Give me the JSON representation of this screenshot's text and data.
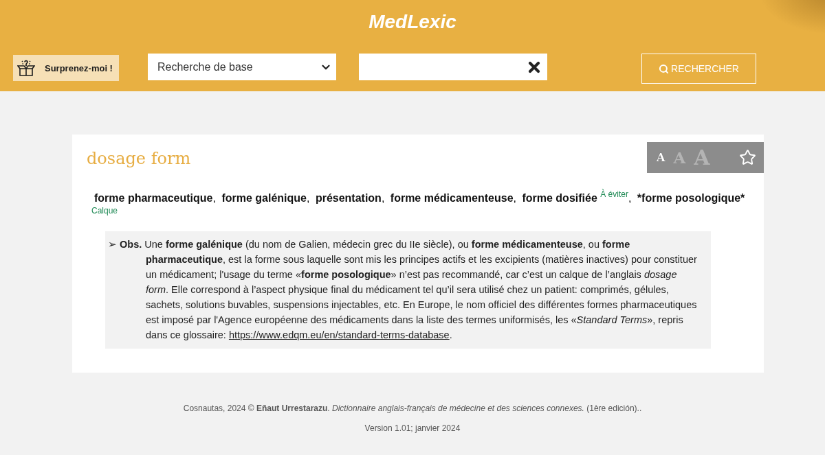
{
  "header": {
    "title": "MedLexic",
    "surprise_button": "Surprenez-moi !",
    "search_mode": "Recherche de base",
    "search_button": "RECHERCHER"
  },
  "entry": {
    "headword": "dosage form",
    "font_sizes": [
      {
        "label": "A",
        "selected": true
      },
      {
        "label": "A",
        "selected": false
      },
      {
        "label": "A",
        "selected": false
      }
    ],
    "favorite": {
      "on": false
    },
    "translations": [
      {
        "term": "forme pharmaceutique",
        "separator": ","
      },
      {
        "term": "forme galénique",
        "separator": ","
      },
      {
        "term": "présentation",
        "separator": ","
      },
      {
        "term": "forme médicamenteuse",
        "separator": ","
      },
      {
        "term": "forme dosifiée",
        "note": "À éviter",
        "separator": ","
      },
      {
        "term": "*forme posologique*",
        "note": "Calque"
      }
    ],
    "observation": {
      "marker": "➢",
      "label": "Obs.",
      "text": "Une **forme galénique** (du nom de Galien, médecin grec du IIe siècle), ou **forme médicamenteuse**, ou **forme pharmaceutique**, est la forme sous laquelle sont mis les principes actifs et les excipients (matières inactives) pour constituer un médicament; l'usage du terme «**forme posologique**» n’est pas recommandé, car c’est un calque de l’anglais *dosage form*. Elle correspond à l’aspect physique final du médicament tel qu’il sera utilisé chez un patient: comprimés, gélules, sachets, solutions buvables, suspensions injectables, etc. En Europe, le nom officiel des différentes formes pharmaceutiques est imposé par l'Agence européenne des médicaments dans la liste des termes uniformisés, les «*Standard Terms*», repris dans ce glossaire: ",
      "link": "https://www.edqm.eu/en/standard-terms-database",
      "ending": "."
    }
  },
  "footer": {
    "credit": "Cosnautas, 2024 © **Eñaut Urrestarazu**. *Dictionnaire anglais-français de médecine et des sciences connexes.* (1ère edición)..",
    "version": "Version 1.01; janvier 2024"
  }
}
